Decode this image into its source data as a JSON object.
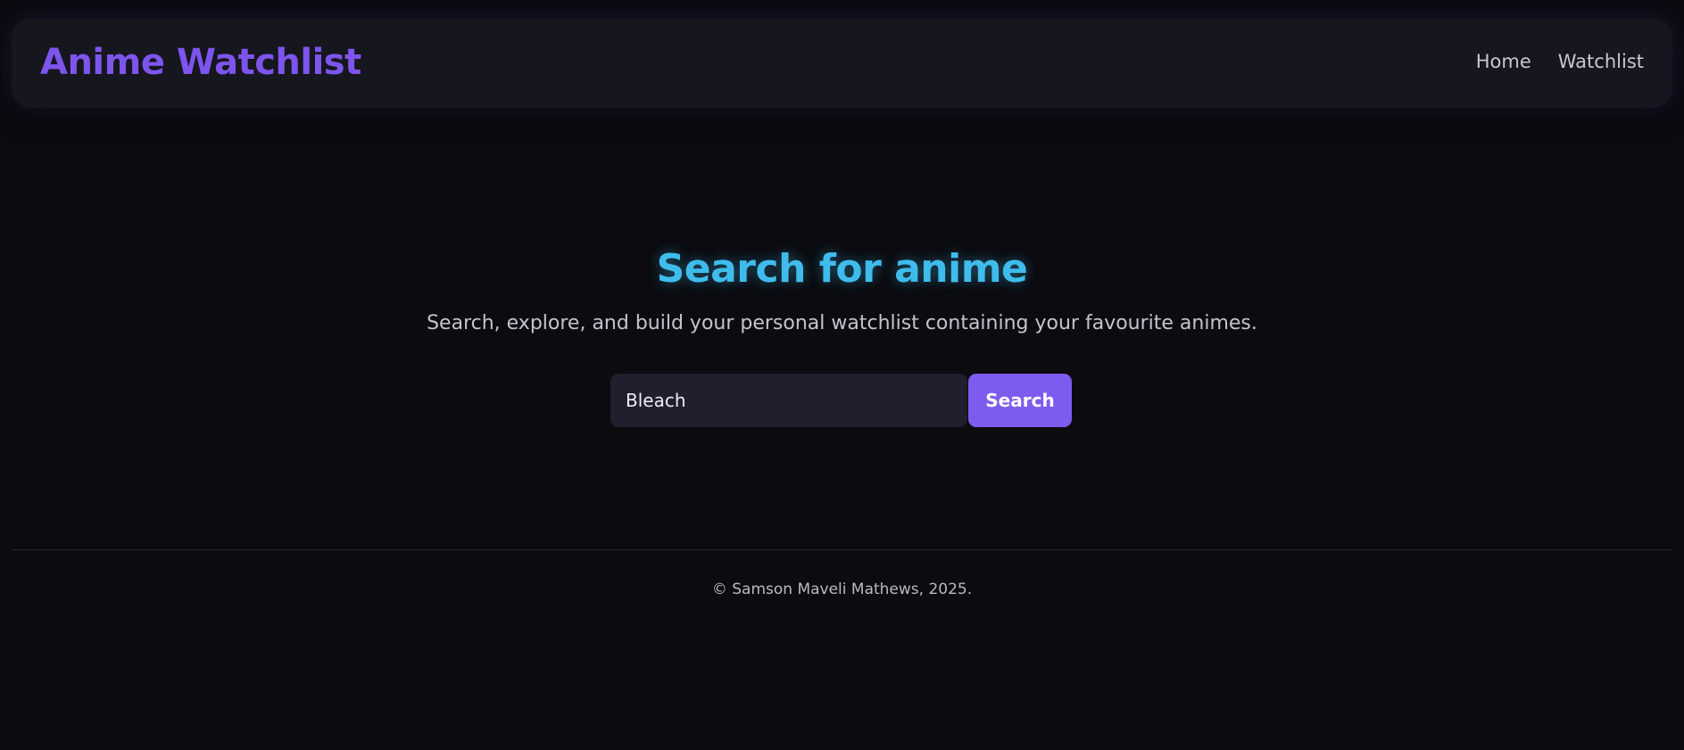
{
  "header": {
    "logo": "Anime Watchlist",
    "nav": [
      {
        "label": "Home"
      },
      {
        "label": "Watchlist"
      }
    ]
  },
  "hero": {
    "title": "Search for anime",
    "subtitle": "Search, explore, and build your personal watchlist containing your favourite animes."
  },
  "search": {
    "value": "Bleach",
    "button_label": "Search"
  },
  "footer": {
    "text": "© Samson Maveli Mathews, 2025."
  },
  "colors": {
    "background": "#0b0b10",
    "header_bg": "#16161f",
    "accent_purple": "#7d55ec",
    "title_cyan": "#3fbcec",
    "input_bg": "#201f2d"
  }
}
